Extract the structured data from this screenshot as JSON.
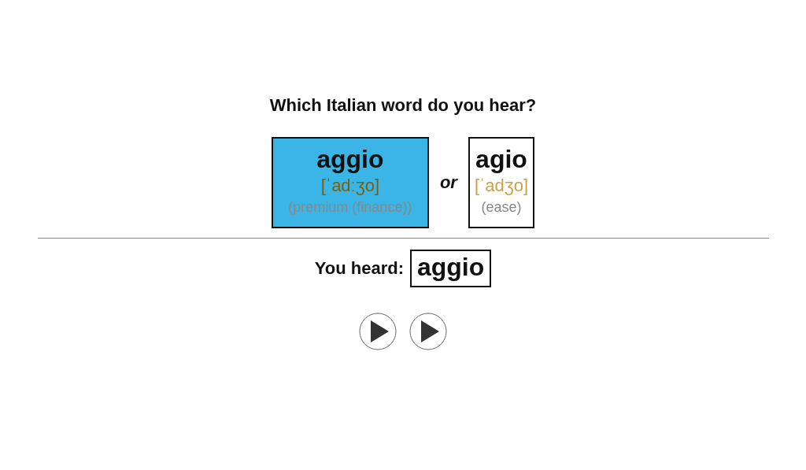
{
  "question": "Which Italian word do you hear?",
  "options": [
    {
      "word": "aggio",
      "ipa": "[ˈadːʒo]",
      "meaning": "(premium (finance))",
      "selected": true
    },
    {
      "word": "agio",
      "ipa": "[ˈadʒo]",
      "meaning": "(ease)",
      "selected": false
    }
  ],
  "separator": "or",
  "result": {
    "label": "You heard:",
    "word": "aggio"
  },
  "play_buttons": [
    {
      "kind": "play"
    },
    {
      "kind": "play"
    }
  ]
}
